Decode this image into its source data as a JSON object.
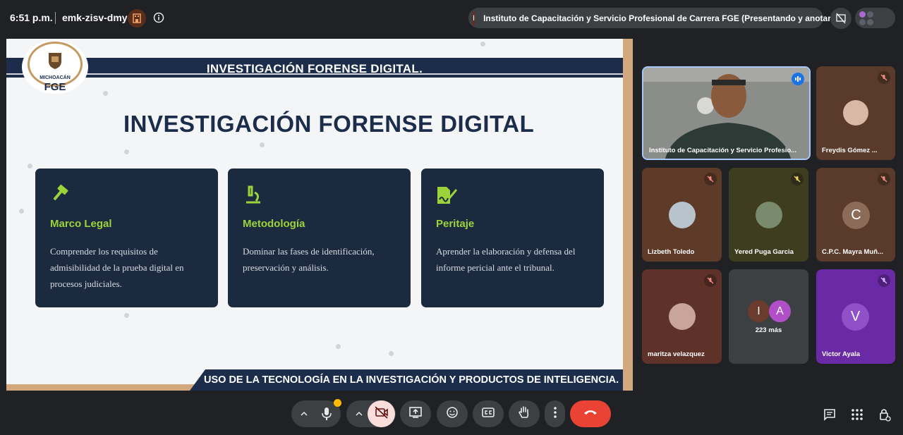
{
  "topbar": {
    "time": "6:51 p.m.",
    "meeting_code": "emk-zisv-dmy",
    "host_badge_icon": "building-icon",
    "info_icon": "info-icon",
    "presenter_initial": "I",
    "presenting_text": "Instituto de Capacitación y Servicio Profesional de Carrera FGE (Presentando y anotando)"
  },
  "slide": {
    "logo_sub": "MICHOACÁN",
    "logo_main": "FGE",
    "banner_title": "INVESTIGACIÓN FORENSE DIGITAL.",
    "heading": "INVESTIGACIÓN FORENSE DIGITAL",
    "cards": [
      {
        "title": "Marco Legal",
        "text": "Comprender los requisitos de admisibilidad de la prueba digital en procesos judiciales.",
        "icon": "gavel-icon"
      },
      {
        "title": "Metodología",
        "text": "Dominar las fases de identificación, preservación y análisis.",
        "icon": "microscope-icon"
      },
      {
        "title": "Peritaje",
        "text": "Aprender la elaboración y defensa del informe pericial ante el tribunal.",
        "icon": "signed-document-icon"
      }
    ],
    "footer": "USO DE LA TECNOLOGÍA EN LA INVESTIGACIÓN Y PRODUCTOS DE INTELIGENCIA."
  },
  "participants": [
    {
      "name": "Instituto de Capacitación y Servicio Profesio...",
      "speaking": true
    },
    {
      "name": "Freydis Gómez ..."
    },
    {
      "name": "Lizbeth Toledo"
    },
    {
      "name": "Yered Puga Garcia"
    },
    {
      "name": "C.P.C. Mayra Muñ...",
      "initial": "C"
    },
    {
      "name": "maritza velazquez"
    },
    {
      "others": "223 más",
      "initials": [
        "I",
        "A"
      ]
    },
    {
      "name": "Victor Ayala",
      "initial": "V"
    }
  ],
  "colors": {
    "accent_green": "#9bd43a",
    "navy": "#1b2d4a",
    "end_call": "#ea4335"
  }
}
